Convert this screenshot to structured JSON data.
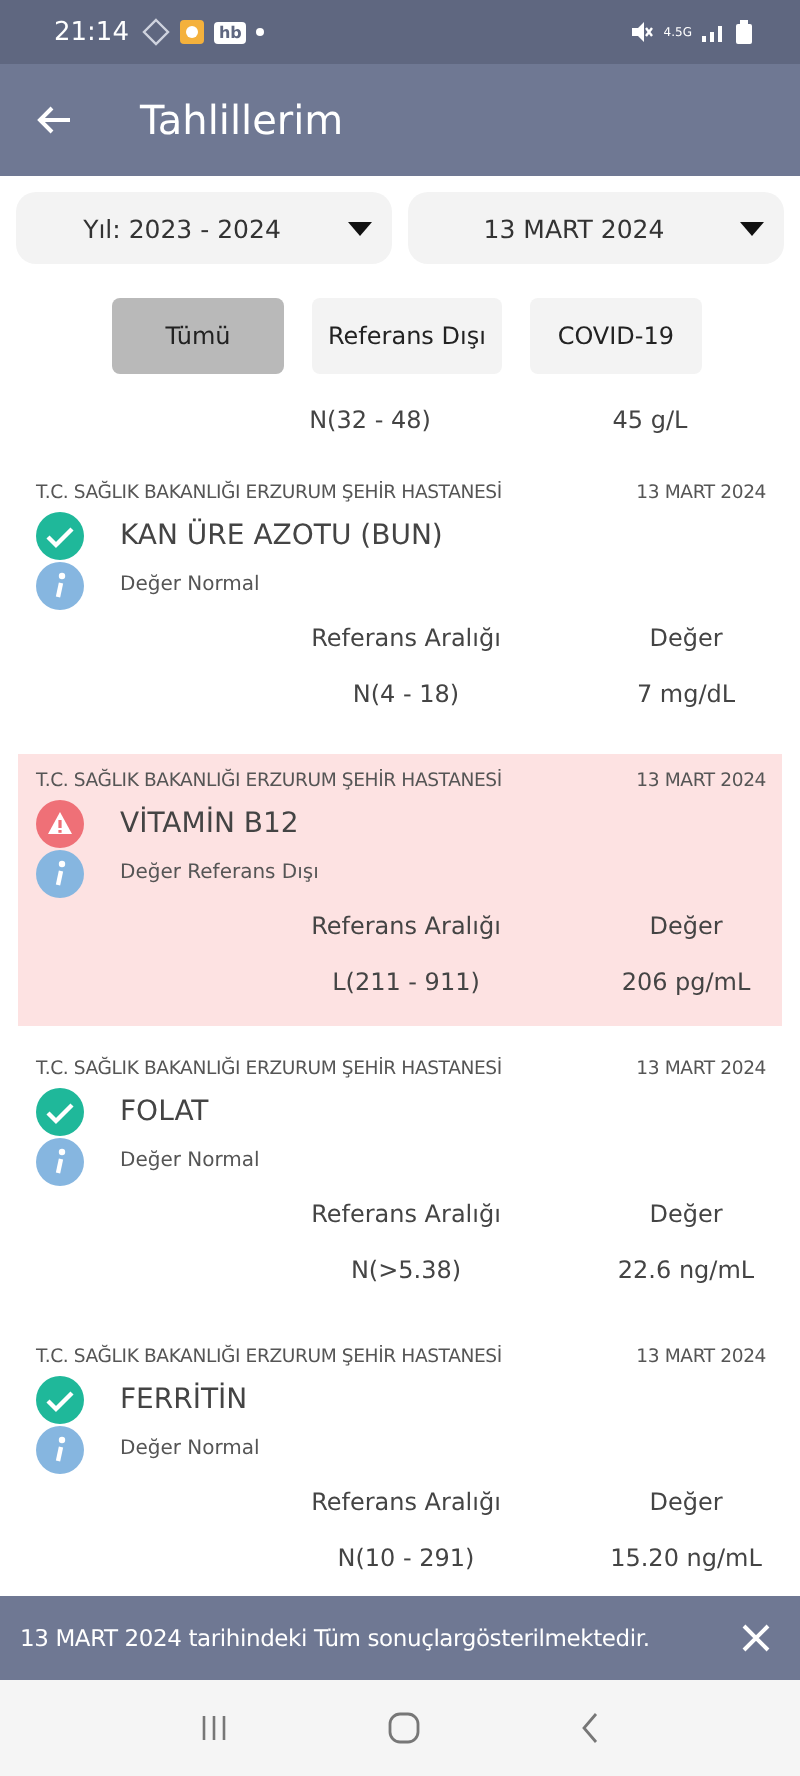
{
  "status_bar": {
    "time": "21:14",
    "app_badge": "hb",
    "network": "4.5G"
  },
  "app_bar": {
    "title": "Tahlillerim"
  },
  "dropdowns": [
    {
      "value": "Yıl: 2023 - 2024"
    },
    {
      "value": "13 MART 2024"
    }
  ],
  "filters": [
    {
      "label": "Tümü",
      "selected": true
    },
    {
      "label": "Referans Dışı",
      "selected": false
    },
    {
      "label": "COVID-19",
      "selected": false
    }
  ],
  "partial_row": {
    "range": "N(32 - 48)",
    "value": "45 g/L"
  },
  "results": [
    {
      "hospital": "T.C. SAĞLIK BAKANLIĞI ERZURUM ŞEHİR HASTANESİ",
      "date": "13 MART 2024",
      "test": "KAN ÜRE AZOTU (BUN)",
      "out_of_range": false,
      "status_text": "Değer Normal",
      "range_label": "Referans Aralığı",
      "value_label": "Değer",
      "range": "N(4 - 18)",
      "value": "7 mg/dL"
    },
    {
      "hospital": "T.C. SAĞLIK BAKANLIĞI ERZURUM ŞEHİR HASTANESİ",
      "date": "13 MART 2024",
      "test": "VİTAMİN B12",
      "out_of_range": true,
      "status_text": "Değer Referans Dışı",
      "range_label": "Referans Aralığı",
      "value_label": "Değer",
      "range": "L(211 - 911)",
      "value": "206 pg/mL"
    },
    {
      "hospital": "T.C. SAĞLIK BAKANLIĞI ERZURUM ŞEHİR HASTANESİ",
      "date": "13 MART 2024",
      "test": "FOLAT",
      "out_of_range": false,
      "status_text": "Değer Normal",
      "range_label": "Referans Aralığı",
      "value_label": "Değer",
      "range": "N(>5.38)",
      "value": "22.6 ng/mL"
    },
    {
      "hospital": "T.C. SAĞLIK BAKANLIĞI ERZURUM ŞEHİR HASTANESİ",
      "date": "13 MART 2024",
      "test": "FERRİTİN",
      "out_of_range": false,
      "status_text": "Değer Normal",
      "range_label": "Referans Aralığı",
      "value_label": "Değer",
      "range": "N(10 - 291)",
      "value": "15.20 ng/mL"
    }
  ],
  "snackbar": {
    "message": "13 MART 2024 tarihindeki Tüm sonuçlargösterilmektedir."
  }
}
